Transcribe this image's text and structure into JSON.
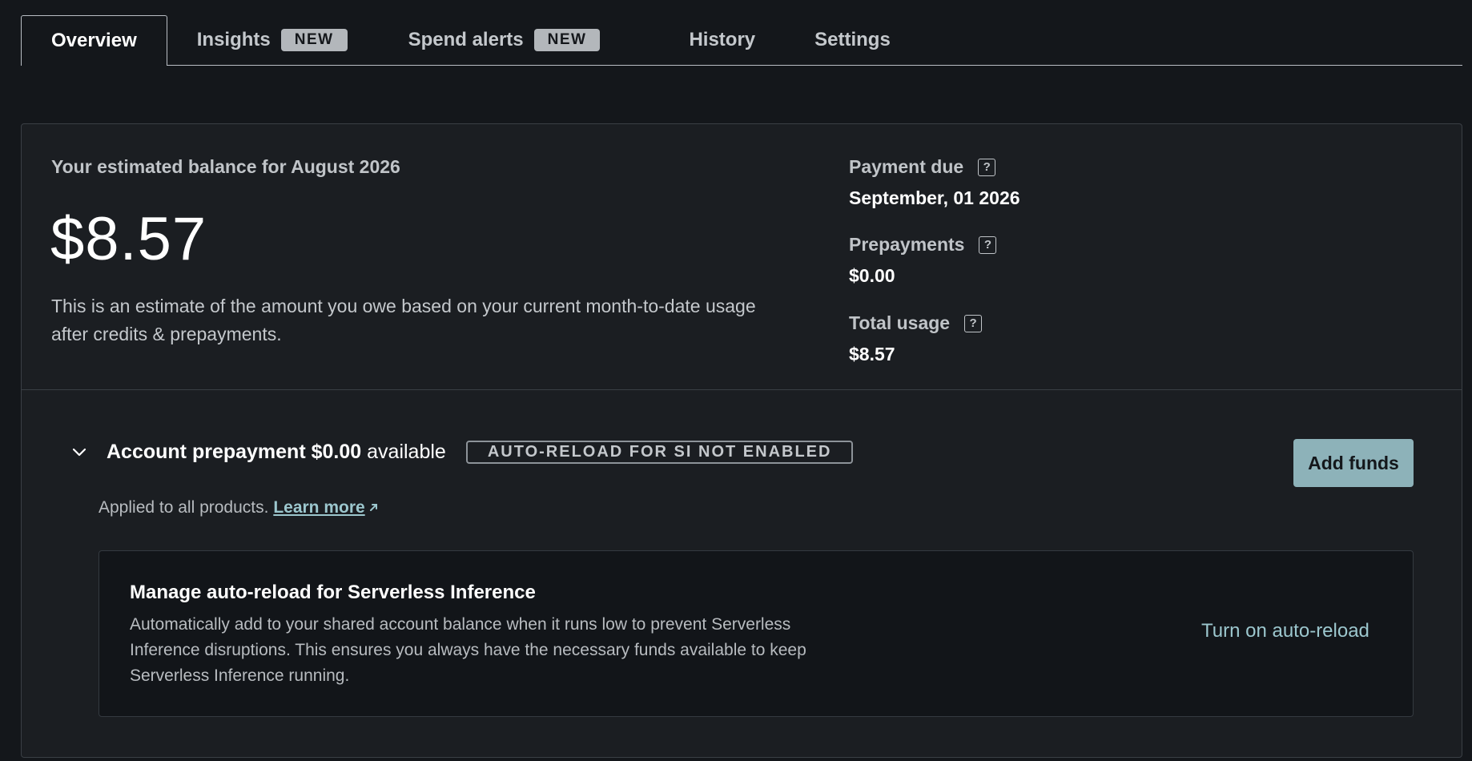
{
  "tabs": [
    {
      "label": "Overview",
      "badge": ""
    },
    {
      "label": "Insights",
      "badge": "NEW"
    },
    {
      "label": "Spend alerts",
      "badge": "NEW"
    },
    {
      "label": "History",
      "badge": ""
    },
    {
      "label": "Settings",
      "badge": ""
    }
  ],
  "summary": {
    "estimate_label": "Your estimated balance for August 2026",
    "balance": "$8.57",
    "description": "This is an estimate of the amount you owe based on your current month-to-date usage after credits & prepayments.",
    "metrics": [
      {
        "label": "Payment due",
        "value": "September, 01 2026"
      },
      {
        "label": "Prepayments",
        "value": "$0.00"
      },
      {
        "label": "Total usage",
        "value": "$8.57"
      }
    ],
    "help_glyph": "?"
  },
  "prepayment": {
    "title_prefix": "Account prepayment",
    "amount": "$0.00",
    "title_suffix": "available",
    "status_badge": "AUTO-RELOAD FOR SI NOT ENABLED",
    "add_funds_label": "Add funds",
    "applied_text": "Applied to all products.",
    "learn_more": "Learn more"
  },
  "auto_reload": {
    "title": "Manage auto-reload for Serverless Inference",
    "description": "Automatically add to your shared account balance when it runs low to prevent Serverless Inference disruptions. This ensures you always have the necessary funds available to keep Serverless Inference running.",
    "action_label": "Turn on auto-reload"
  },
  "icons": {
    "chevron": "chevron-down-icon",
    "external": "external-link-icon",
    "help": "help-icon"
  },
  "colors": {
    "background": "#14171b",
    "card": "#1b1e22",
    "accent": "#8db2b9",
    "link": "#9cc7ce"
  }
}
